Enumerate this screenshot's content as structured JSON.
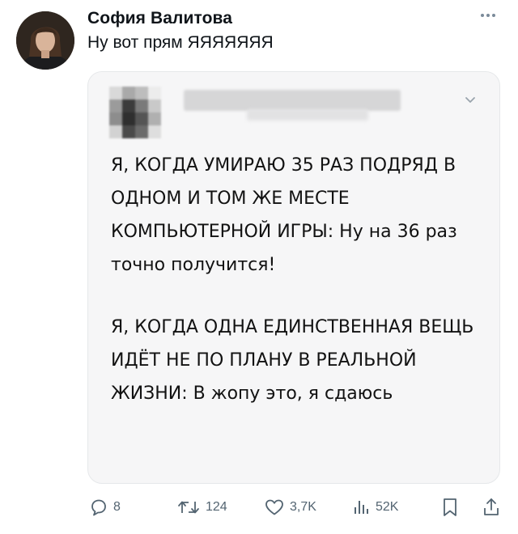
{
  "post": {
    "author_name": "София Валитова",
    "text": "Ну вот прям ЯЯЯЯЯЯЯ"
  },
  "quote": {
    "paragraph1": "Я, КОГДА УМИРАЮ 35 РАЗ ПОДРЯД В ОДНОМ И ТОМ ЖЕ МЕСТЕ КОМПЬЮТЕРНОЙ ИГРЫ: Ну на 36 раз точно получится!",
    "paragraph2": "Я, КОГДА ОДНА ЕДИНСТВЕННАЯ ВЕЩЬ ИДЁТ НЕ ПО ПЛАНУ В РЕАЛЬНОЙ ЖИЗНИ: В жопу это, я сдаюсь"
  },
  "actions": {
    "replies": "8",
    "reposts": "124",
    "likes": "3,7K",
    "views": "52K"
  },
  "icons": {
    "more": "more-dots-icon",
    "reply": "reply-bubble-icon",
    "repost": "repost-icon",
    "like": "heart-icon",
    "views": "views-bars-icon",
    "bookmark": "bookmark-icon",
    "share": "share-icon",
    "quote_menu": "chevron-down-icon"
  },
  "colors": {
    "text": "#0f1419",
    "secondary": "#536471",
    "card_background": "#f6f6f7",
    "card_border": "#e6e8ea"
  }
}
